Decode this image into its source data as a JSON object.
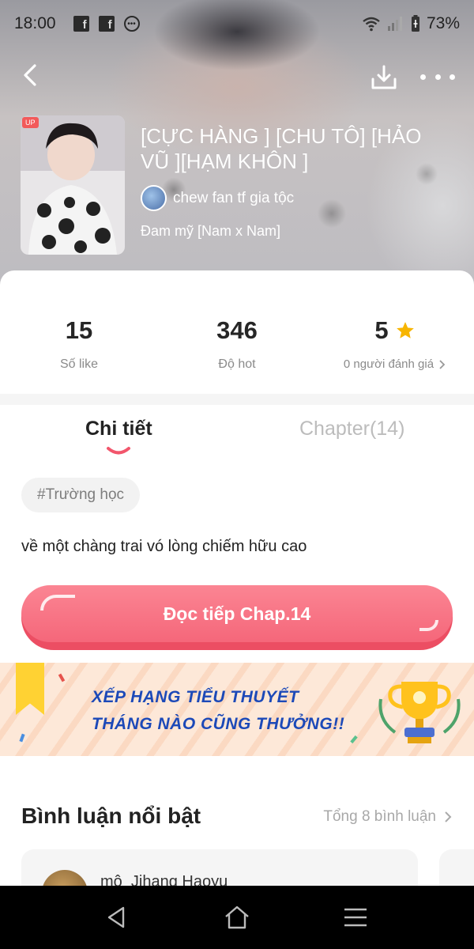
{
  "status_bar": {
    "time": "18:00",
    "battery": "73%",
    "apps": [
      "facebook-icon",
      "facebook-icon",
      "messenger-icon"
    ]
  },
  "story": {
    "title": "[CỰC HÀNG ] [CHU TÔ] [HẢO VŨ ][HẠM KHÔN ]",
    "author": "chew fan tf gia tộc",
    "genre": "Đam mỹ [Nam x Nam]",
    "badge": "UP"
  },
  "stats": {
    "likes_value": "15",
    "likes_label": "Số like",
    "hot_value": "346",
    "hot_label": "Độ hot",
    "rating_value": "5",
    "rating_label": "0 người đánh giá"
  },
  "tabs": {
    "details": "Chi tiết",
    "chapters": "Chapter(14)"
  },
  "tag": "#Trường học",
  "description": "về một chàng trai vó lòng chiếm hữu cao",
  "read_button": "Đọc tiếp Chap.14",
  "banner": {
    "line1": "XẾP HẠNG TIỂU THUYẾT",
    "line2": "THÁNG NÀO CŨNG THƯỞNG!!"
  },
  "comments": {
    "title": "Bình luận nổi bật",
    "total": "Tổng 8 bình luận",
    "first_user": "mộ_Jihang Haoyu"
  },
  "colors": {
    "accent": "#f5677a",
    "accent_dark": "#ec4e63",
    "star": "#f7b500",
    "banner_text": "#1c49b8"
  }
}
